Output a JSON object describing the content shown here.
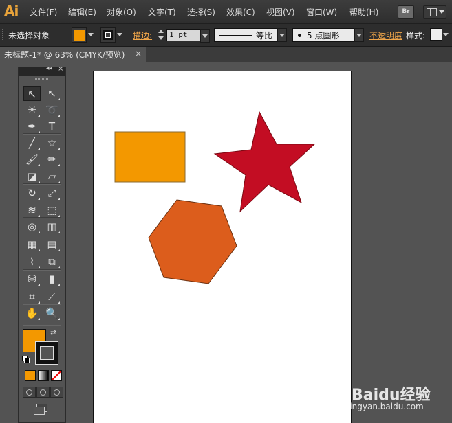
{
  "app": {
    "logo": "Ai"
  },
  "menubar": {
    "items": [
      {
        "label": "文件(F)"
      },
      {
        "label": "编辑(E)"
      },
      {
        "label": "对象(O)"
      },
      {
        "label": "文字(T)"
      },
      {
        "label": "选择(S)"
      },
      {
        "label": "效果(C)"
      },
      {
        "label": "视图(V)"
      },
      {
        "label": "窗口(W)"
      },
      {
        "label": "帮助(H)"
      }
    ],
    "bridge_label": "Br"
  },
  "controlbar": {
    "selection_label": "未选择对象",
    "fill_color": "#f39800",
    "stroke_label": "描边:",
    "stroke_weight": "1 pt",
    "profile_label": "等比",
    "brush_label": "5 点圆形",
    "opacity_label": "不透明度",
    "style_label": "样式:"
  },
  "document": {
    "tab_title": "未标题-1* @ 63% (CMYK/预览)",
    "close_glyph": "×"
  },
  "tools_panel": {
    "collapse_glyph": "◂◂",
    "close_glyph": "×",
    "fill_color": "#f39800",
    "tools": [
      {
        "name": "selection-tool",
        "glyph": "↖"
      },
      {
        "name": "direct-selection-tool",
        "glyph": "↖"
      },
      {
        "name": "magic-wand-tool",
        "glyph": "✳"
      },
      {
        "name": "lasso-tool",
        "glyph": "➰"
      },
      {
        "name": "pen-tool",
        "glyph": "✒"
      },
      {
        "name": "type-tool",
        "glyph": "T"
      },
      {
        "name": "line-segment-tool",
        "glyph": "╱"
      },
      {
        "name": "star-tool",
        "glyph": "☆"
      },
      {
        "name": "paintbrush-tool",
        "glyph": "🖌"
      },
      {
        "name": "pencil-tool",
        "glyph": "✏"
      },
      {
        "name": "blob-brush-tool",
        "glyph": "◪"
      },
      {
        "name": "eraser-tool",
        "glyph": "▱"
      },
      {
        "name": "rotate-tool",
        "glyph": "↻"
      },
      {
        "name": "scale-tool",
        "glyph": "⤢"
      },
      {
        "name": "warp-tool",
        "glyph": "≋"
      },
      {
        "name": "free-transform-tool",
        "glyph": "⬚"
      },
      {
        "name": "shape-builder-tool",
        "glyph": "◎"
      },
      {
        "name": "perspective-grid-tool",
        "glyph": "▥"
      },
      {
        "name": "mesh-tool",
        "glyph": "▦"
      },
      {
        "name": "gradient-tool",
        "glyph": "▤"
      },
      {
        "name": "eyedropper-tool",
        "glyph": "⌇"
      },
      {
        "name": "blend-tool",
        "glyph": "⧉"
      },
      {
        "name": "symbol-sprayer-tool",
        "glyph": "⛁"
      },
      {
        "name": "column-graph-tool",
        "glyph": "▮"
      },
      {
        "name": "artboard-tool",
        "glyph": "⌗"
      },
      {
        "name": "slice-tool",
        "glyph": "⟋"
      },
      {
        "name": "hand-tool",
        "glyph": "✋"
      },
      {
        "name": "zoom-tool",
        "glyph": "🔍"
      }
    ],
    "mode_colors": [
      "#f39800",
      "#ffffff",
      "#ffffff"
    ]
  },
  "artwork": {
    "rectangle_color": "#f39800",
    "star_color": "#c30d23",
    "hexagon_color": "#dc5d1c"
  },
  "watermark": {
    "brand": "Baidu经验",
    "url": "jingyan.baidu.com"
  }
}
